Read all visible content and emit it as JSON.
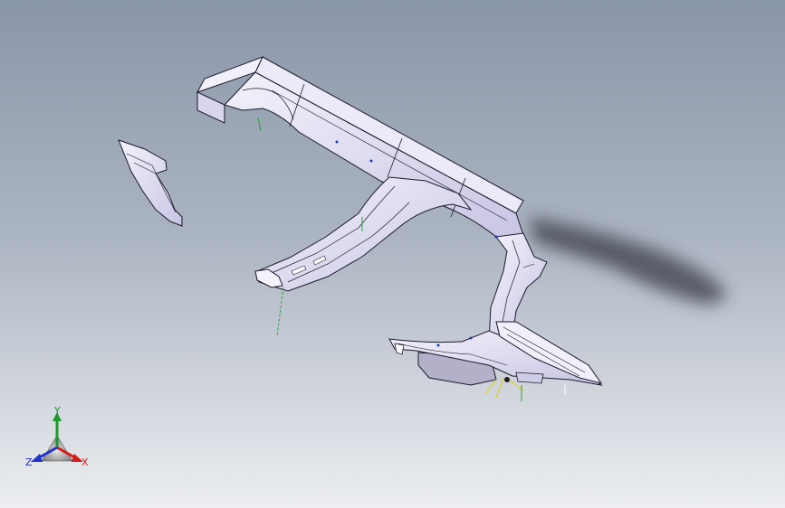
{
  "viewport": {
    "background_top": "#8a96a9",
    "background_bottom": "#eceef1"
  },
  "model": {
    "part_fill": "#e6e4f6",
    "part_shade": "#c9c6e6",
    "edge_color": "#1a1a2a",
    "shadow_color": "#3a3e46"
  },
  "triad": {
    "x_label": "X",
    "y_label": "Y",
    "z_label": "Z",
    "x_color": "#d21c1c",
    "y_color": "#1c9a2c",
    "z_color": "#2233cc"
  }
}
